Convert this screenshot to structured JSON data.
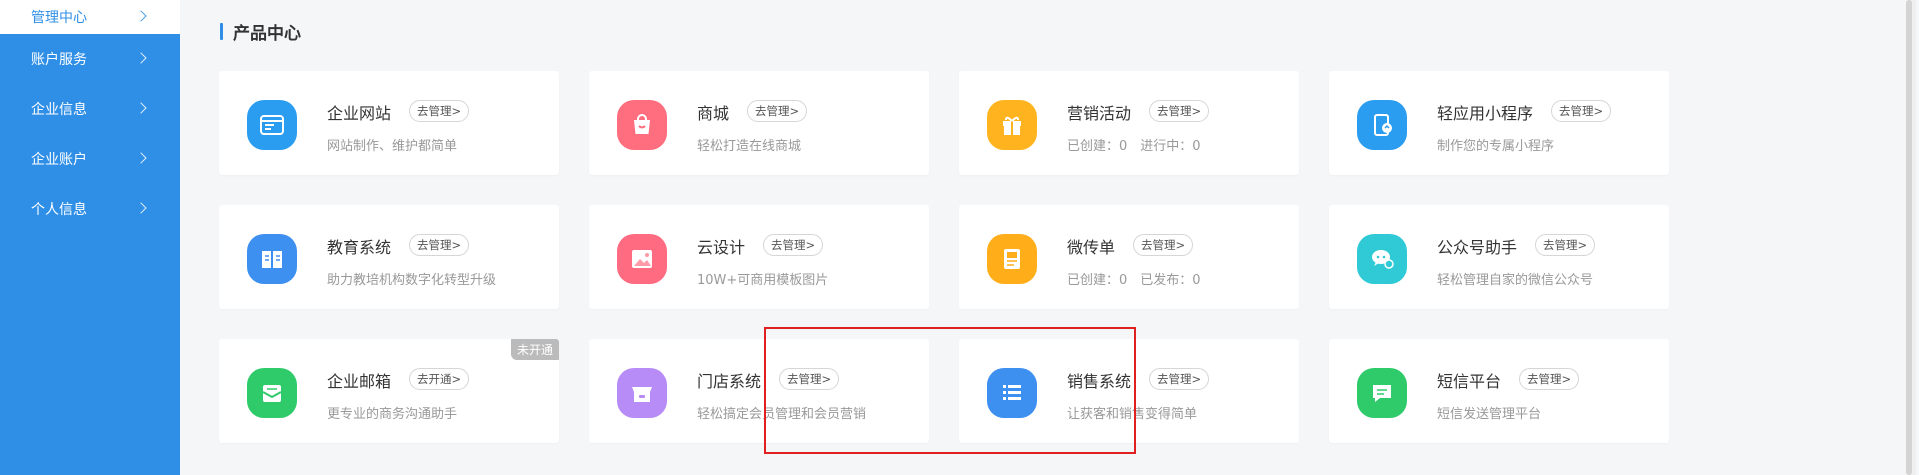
{
  "sidebar": {
    "items": [
      {
        "label": "管理中心",
        "active": true
      },
      {
        "label": "账户服务",
        "active": false
      },
      {
        "label": "企业信息",
        "active": false
      },
      {
        "label": "企业账户",
        "active": false
      },
      {
        "label": "个人信息",
        "active": false
      }
    ]
  },
  "main": {
    "section_title": "产品中心",
    "cards": [
      {
        "title": "企业网站",
        "manage_label": "去管理>",
        "desc": "网站制作、维护都简单",
        "icon": "website-icon",
        "color": "#2b9df0"
      },
      {
        "title": "商城",
        "manage_label": "去管理>",
        "desc": "轻松打造在线商城",
        "icon": "shopping-bag-icon",
        "color": "#ff6e7f"
      },
      {
        "title": "营销活动",
        "manage_label": "去管理>",
        "desc": "已创建：0　进行中：0",
        "icon": "gift-icon",
        "color": "#ffb31f"
      },
      {
        "title": "轻应用小程序",
        "manage_label": "去管理>",
        "desc": "制作您的专属小程序",
        "icon": "mini-program-icon",
        "color": "#2b9df0"
      },
      {
        "title": "教育系统",
        "manage_label": "去管理>",
        "desc": "助力教培机构数字化转型升级",
        "icon": "book-icon",
        "color": "#3d8ff0"
      },
      {
        "title": "云设计",
        "manage_label": "去管理>",
        "desc": "10W+可商用模板图片",
        "icon": "image-icon",
        "color": "#ff6b81"
      },
      {
        "title": "微传单",
        "manage_label": "去管理>",
        "desc": "已创建：0　已发布：0",
        "icon": "flyer-icon",
        "color": "#ffae1a"
      },
      {
        "title": "公众号助手",
        "manage_label": "去管理>",
        "desc": "轻松管理自家的微信公众号",
        "icon": "wechat-icon",
        "color": "#30c9d6"
      },
      {
        "title": "企业邮箱",
        "manage_label": "去开通>",
        "desc": "更专业的商务沟通助手",
        "icon": "mail-icon",
        "color": "#2fcb6b",
        "badge": "未开通"
      },
      {
        "title": "门店系统",
        "manage_label": "去管理>",
        "desc": "轻松搞定会员管理和会员营销",
        "icon": "store-icon",
        "color": "#b88cf7"
      },
      {
        "title": "销售系统",
        "manage_label": "去管理>",
        "desc": "让获客和销售变得简单",
        "icon": "list-icon",
        "color": "#3d8ff0"
      },
      {
        "title": "短信平台",
        "manage_label": "去管理>",
        "desc": "短信发送管理平台",
        "icon": "sms-icon",
        "color": "#2fcb6b"
      }
    ]
  }
}
